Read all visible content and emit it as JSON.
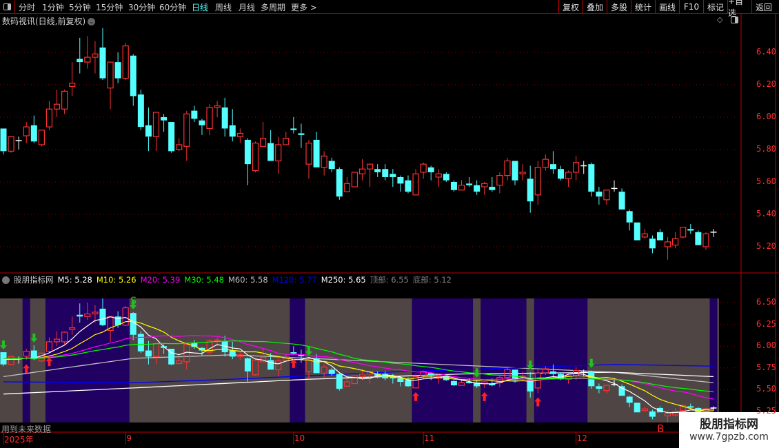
{
  "toolbar": {
    "tabs": [
      "分时",
      "1分钟",
      "5分钟",
      "15分钟",
      "30分钟",
      "60分钟",
      "日线",
      "周线",
      "月线",
      "多周期",
      "更多 >"
    ],
    "active_tab": "日线",
    "buttons": [
      "复权",
      "叠加",
      "多股",
      "统计",
      "画线",
      "F10",
      "标记",
      "+自选",
      "返回"
    ]
  },
  "main": {
    "title": "数码视讯(日线,前复权)",
    "price_ticks": [
      "6.40",
      "6.20",
      "6.00",
      "5.80",
      "5.60",
      "5.40",
      "5.20"
    ]
  },
  "indicator": {
    "name": "股朋指标网",
    "ma_labels": [
      {
        "text": "M5: 5.28",
        "color": "#ffffff"
      },
      {
        "text": "M10: 5.26",
        "color": "#ffff00"
      },
      {
        "text": "M20: 5.39",
        "color": "#ff00ff"
      },
      {
        "text": "M30: 5.48",
        "color": "#00ff00"
      },
      {
        "text": "M60: 5.58",
        "color": "#c0c0c0"
      },
      {
        "text": "M120: 5.77",
        "color": "#0000ff"
      },
      {
        "text": "M250: 5.65",
        "color": "#ffffff"
      },
      {
        "text": "顶部: 6.55",
        "color": "#808080"
      },
      {
        "text": "底部: 5.12",
        "color": "#808080"
      }
    ],
    "price_ticks": [
      "6.50",
      "6.25",
      "6.00",
      "5.75",
      "5.50",
      "5.25"
    ],
    "note": "用到未来数据",
    "b_marker": "B"
  },
  "dates": [
    {
      "label": "2025年",
      "index": 1
    },
    {
      "label": "9",
      "index": 17
    },
    {
      "label": "10",
      "index": 39
    },
    {
      "label": "11",
      "index": 56
    },
    {
      "label": "12",
      "index": 76
    }
  ],
  "watermark": {
    "line1": "股朋指标网",
    "line2": "www.7gpzb.com"
  },
  "colors": {
    "up": "#ff3232",
    "down": "#54ffff",
    "doji": "#ffffff",
    "panel_bg": "#504545",
    "signal_bg": "#200060",
    "grid": "#900000"
  },
  "chart_data": {
    "type": "candlestick",
    "ylim_main": [
      5.1,
      6.55
    ],
    "ylim_indicator": [
      5.2,
      6.55
    ],
    "ohlc": [
      [
        5.93,
        5.93,
        5.77,
        5.79
      ],
      [
        5.79,
        5.88,
        5.78,
        5.88
      ],
      [
        5.855,
        5.88,
        5.8,
        5.855
      ],
      [
        5.885,
        5.97,
        5.84,
        5.94
      ],
      [
        5.95,
        6.01,
        5.84,
        5.85
      ],
      [
        5.83,
        5.92,
        5.82,
        5.92
      ],
      [
        5.94,
        6.1,
        5.92,
        6.05
      ],
      [
        6.05,
        6.17,
        6.0,
        6.08
      ],
      [
        6.05,
        6.17,
        6.02,
        6.16
      ],
      [
        6.19,
        6.34,
        6.13,
        6.21
      ],
      [
        6.36,
        6.49,
        6.27,
        6.34
      ],
      [
        6.34,
        6.5,
        6.3,
        6.37
      ],
      [
        6.37,
        6.47,
        6.27,
        6.39
      ],
      [
        6.43,
        6.55,
        6.23,
        6.24
      ],
      [
        6.18,
        6.34,
        6.05,
        6.34
      ],
      [
        6.34,
        6.4,
        6.21,
        6.24
      ],
      [
        6.24,
        6.46,
        6.23,
        6.44
      ],
      [
        6.38,
        6.39,
        6.07,
        6.13
      ],
      [
        6.14,
        6.17,
        5.92,
        5.94
      ],
      [
        5.95,
        6.06,
        5.79,
        5.88
      ],
      [
        5.88,
        6.03,
        5.79,
        6.03
      ],
      [
        6.0,
        6.02,
        5.91,
        5.98
      ],
      [
        5.97,
        5.97,
        5.78,
        5.79
      ],
      [
        5.8,
        5.87,
        5.79,
        5.83
      ],
      [
        5.82,
        6.04,
        5.73,
        6.02
      ],
      [
        6.04,
        6.07,
        5.97,
        5.99
      ],
      [
        5.98,
        5.99,
        5.89,
        5.95
      ],
      [
        5.93,
        6.08,
        5.89,
        6.06
      ],
      [
        6.06,
        6.1,
        6.0,
        6.07
      ],
      [
        6.06,
        6.12,
        5.88,
        5.93
      ],
      [
        5.95,
        6.05,
        5.85,
        5.88
      ],
      [
        5.88,
        5.93,
        5.84,
        5.9
      ],
      [
        5.86,
        5.87,
        5.58,
        5.71
      ],
      [
        5.67,
        5.85,
        5.66,
        5.84
      ],
      [
        5.82,
        5.97,
        5.82,
        5.87
      ],
      [
        5.84,
        5.92,
        5.73,
        5.73
      ],
      [
        5.73,
        5.88,
        5.65,
        5.83
      ],
      [
        5.83,
        5.91,
        5.83,
        5.87
      ],
      [
        5.93,
        6.0,
        5.9,
        5.92
      ],
      [
        5.9,
        5.96,
        5.81,
        5.89
      ],
      [
        5.71,
        5.86,
        5.62,
        5.84
      ],
      [
        5.86,
        5.91,
        5.69,
        5.69
      ],
      [
        5.69,
        5.79,
        5.64,
        5.76
      ],
      [
        5.73,
        5.75,
        5.66,
        5.68
      ],
      [
        5.68,
        5.69,
        5.49,
        5.51
      ],
      [
        5.54,
        5.63,
        5.54,
        5.59
      ],
      [
        5.57,
        5.66,
        5.57,
        5.66
      ],
      [
        5.65,
        5.74,
        5.61,
        5.68
      ],
      [
        5.68,
        5.71,
        5.57,
        5.71
      ],
      [
        5.68,
        5.71,
        5.63,
        5.66
      ],
      [
        5.68,
        5.71,
        5.61,
        5.63
      ],
      [
        5.65,
        5.68,
        5.57,
        5.63
      ],
      [
        5.63,
        5.64,
        5.54,
        5.59
      ],
      [
        5.61,
        5.64,
        5.53,
        5.54
      ],
      [
        5.52,
        5.68,
        5.52,
        5.65
      ],
      [
        5.66,
        5.72,
        5.62,
        5.71
      ],
      [
        5.69,
        5.7,
        5.61,
        5.66
      ],
      [
        5.63,
        5.68,
        5.57,
        5.65
      ],
      [
        5.65,
        5.66,
        5.6,
        5.61
      ],
      [
        5.6,
        5.61,
        5.54,
        5.55
      ],
      [
        5.55,
        5.61,
        5.55,
        5.58
      ],
      [
        5.59,
        5.63,
        5.57,
        5.58
      ],
      [
        5.58,
        5.61,
        5.52,
        5.54
      ],
      [
        5.57,
        5.6,
        5.52,
        5.59
      ],
      [
        5.57,
        5.63,
        5.54,
        5.55
      ],
      [
        5.58,
        5.66,
        5.53,
        5.64
      ],
      [
        5.64,
        5.75,
        5.61,
        5.73
      ],
      [
        5.73,
        5.73,
        5.58,
        5.61
      ],
      [
        5.65,
        5.71,
        5.61,
        5.66
      ],
      [
        5.62,
        5.7,
        5.41,
        5.48
      ],
      [
        5.52,
        5.73,
        5.46,
        5.69
      ],
      [
        5.69,
        5.77,
        5.67,
        5.74
      ],
      [
        5.71,
        5.79,
        5.65,
        5.68
      ],
      [
        5.68,
        5.7,
        5.61,
        5.62
      ],
      [
        5.62,
        5.67,
        5.57,
        5.66
      ],
      [
        5.66,
        5.76,
        5.61,
        5.72
      ],
      [
        5.7,
        5.73,
        5.65,
        5.7
      ],
      [
        5.71,
        5.72,
        5.51,
        5.54
      ],
      [
        5.54,
        5.57,
        5.46,
        5.51
      ],
      [
        5.49,
        5.55,
        5.46,
        5.55
      ],
      [
        5.56,
        5.61,
        5.54,
        5.56
      ],
      [
        5.54,
        5.56,
        5.43,
        5.43
      ],
      [
        5.42,
        5.43,
        5.3,
        5.35
      ],
      [
        5.35,
        5.35,
        5.24,
        5.24
      ],
      [
        5.26,
        5.31,
        5.25,
        5.28
      ],
      [
        5.25,
        5.27,
        5.16,
        5.19
      ],
      [
        5.29,
        5.31,
        5.24,
        5.24
      ],
      [
        5.2,
        5.26,
        5.12,
        5.23
      ],
      [
        5.21,
        5.29,
        5.19,
        5.25
      ],
      [
        5.26,
        5.32,
        5.25,
        5.32
      ],
      [
        5.31,
        5.34,
        5.28,
        5.3
      ],
      [
        5.29,
        5.3,
        5.21,
        5.21
      ],
      [
        5.2,
        5.29,
        5.18,
        5.28
      ],
      [
        5.29,
        5.31,
        5.26,
        5.29
      ]
    ],
    "long_ma": [
      {
        "name": "M60",
        "color": "#c0c0c0",
        "points": [
          [
            1,
            5.65
          ],
          [
            18,
            5.86
          ],
          [
            31,
            5.9
          ],
          [
            51,
            5.82
          ],
          [
            71,
            5.74
          ],
          [
            81,
            5.7
          ],
          [
            94,
            5.58
          ]
        ]
      },
      {
        "name": "M120",
        "color": "#0000ff",
        "points": [
          [
            1,
            5.59
          ],
          [
            18,
            5.58
          ],
          [
            31,
            5.62
          ],
          [
            51,
            5.7
          ],
          [
            71,
            5.76
          ],
          [
            81,
            5.79
          ],
          [
            94,
            5.77
          ]
        ]
      },
      {
        "name": "M250",
        "color": "#ffffff",
        "points": [
          [
            1,
            5.45
          ],
          [
            18,
            5.52
          ],
          [
            41,
            5.62
          ],
          [
            61,
            5.68
          ],
          [
            81,
            5.7
          ],
          [
            94,
            5.65
          ]
        ]
      }
    ],
    "short_ma": [
      {
        "name": "M5",
        "period": 5,
        "color": "#ffffff"
      },
      {
        "name": "M10",
        "period": 10,
        "color": "#ffff00"
      },
      {
        "name": "M20",
        "period": 20,
        "color": "#ff00ff"
      },
      {
        "name": "M30",
        "period": 30,
        "color": "#00ff00"
      }
    ],
    "signal_ranges": [
      [
        4,
        4
      ],
      [
        7,
        17
      ],
      [
        39,
        40
      ],
      [
        55,
        62
      ],
      [
        64,
        69
      ],
      [
        71,
        77
      ],
      [
        94,
        94
      ]
    ],
    "buy_arrows": [
      4,
      7,
      39,
      55,
      64,
      71
    ],
    "sell_arrows": [
      1,
      5,
      18,
      41,
      63,
      70,
      78
    ],
    "s_label": {
      "index": 18,
      "text": "S"
    }
  }
}
